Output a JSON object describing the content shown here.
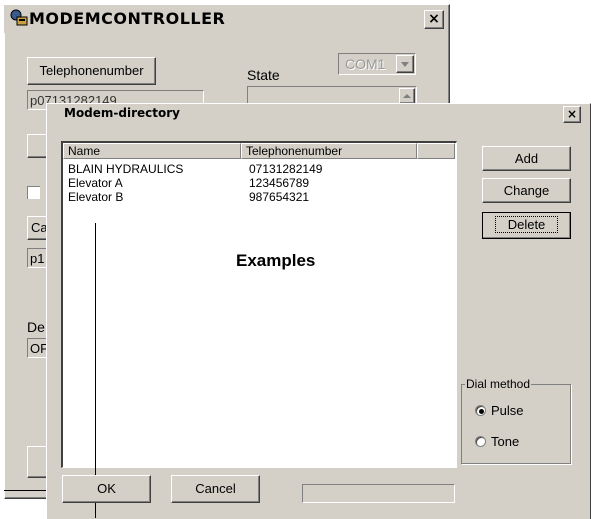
{
  "main_window": {
    "title": "MODEMCONTROLLER",
    "close_label": "×",
    "telephone_button": "Telephonenumber",
    "state_label": "State",
    "port_value": "COM1",
    "phone_value": "p07131282149",
    "partial_button": "Ca",
    "partial_field": "p1",
    "partial_label": "De",
    "partial_status": "OF"
  },
  "dialog": {
    "title": "Modem-directory",
    "close_label": "×",
    "columns": [
      "Name",
      "Telephonenumber"
    ],
    "rows": [
      {
        "name": "BLAIN HYDRAULICS",
        "number": "07131282149"
      },
      {
        "name": "Elevator A",
        "number": "123456789"
      },
      {
        "name": "Elevator B",
        "number": "987654321"
      }
    ],
    "examples_label": "Examples",
    "buttons": {
      "add": "Add",
      "change": "Change",
      "delete": "Delete",
      "ok": "OK",
      "cancel": "Cancel"
    },
    "dial_method": {
      "label": "Dial method",
      "options": [
        "Pulse",
        "Tone"
      ],
      "selected": "Pulse"
    }
  }
}
